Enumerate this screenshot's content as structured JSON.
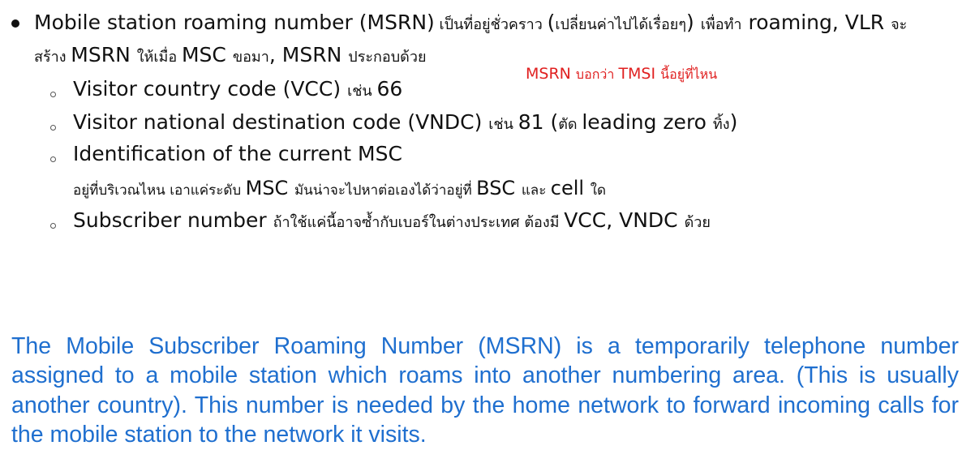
{
  "bullet": {
    "line1_bold_a": "Mobile station roaming number (MSRN)",
    "line1_thai_a": " เป็นที่อยู่ชั่วคราว ",
    "line1_bold_b": "(",
    "line1_thai_b": "เปลี่ยนค่าไปได้เรื่อยๆ",
    "line1_bold_c": ") ",
    "line1_thai_c": "เพื่อทำ",
    "line1_bold_d": " roaming, VLR ",
    "line1_thai_d": "จะ",
    "line2_thai_a": "สร้าง ",
    "line2_bold_a": "MSRN ",
    "line2_thai_b": "ให้เมื่อ ",
    "line2_bold_b": "MSC ",
    "line2_thai_c": "ขอมา",
    "line2_bold_c": ", MSRN ",
    "line2_thai_d": "ประกอบด้วย"
  },
  "red_note": {
    "a": "MSRN ",
    "b": "บอกว่า ",
    "c": "TMSI ",
    "d": "นี้อยู่ที่ไหน"
  },
  "sub_items": [
    {
      "main": "Visitor country code (VCC) ",
      "thai": "เช่น ",
      "tail": "66"
    },
    {
      "main": "Visitor national destination code (VNDC) ",
      "thai": "เช่น ",
      "tail": "81 (",
      "thai2": "ตัด ",
      "tail2": "leading zero ",
      "thai3": "ทิ้ง",
      "tail3": ")"
    },
    {
      "main": "Identification of the current MSC"
    },
    {
      "main": "Subscriber number ",
      "thai": "ถ้าใช้แค่นี้อาจซ้ำกับเบอร์ในต่างประเทศ ต้องมี ",
      "tail": "VCC, VNDC ",
      "thai2": "ด้วย"
    }
  ],
  "msc_note": {
    "thai_a": "อยู่ที่บริเวณไหน เอาแค่ระดับ ",
    "bold_a": "MSC ",
    "thai_b": "มันน่าจะไปหาต่อเองได้ว่าอยู่ที่ ",
    "bold_b": "BSC ",
    "thai_c": "และ ",
    "bold_c": "cell ",
    "thai_d": "ใด"
  },
  "english_paragraph": "The Mobile Subscriber Roaming Number (MSRN) is a temporarily telephone number assigned to a mobile station which roams into another numbering area. (This is usually another country). This number is needed by the home network to forward incoming calls for the mobile station to the network it visits.",
  "colors": {
    "text": "#111111",
    "red_note": "#e02020",
    "paragraph_blue": "#1f6fcf"
  }
}
